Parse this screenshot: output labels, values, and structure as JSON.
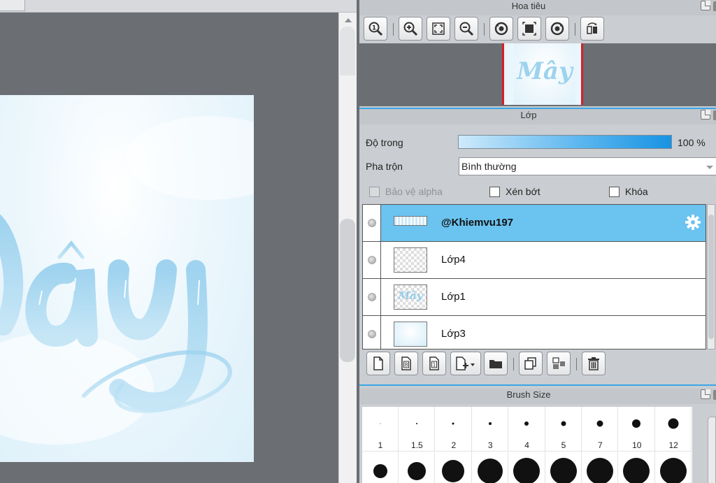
{
  "navigator": {
    "title": "Hoa tiêu",
    "preview_text": "Mây",
    "tools": [
      "zoom-actual-icon",
      "zoom-in-icon",
      "fit-window-icon",
      "zoom-out-icon",
      "rotate-left-icon",
      "fit-canvas-icon",
      "rotate-right-icon",
      "flip-horizontal-icon"
    ]
  },
  "canvas": {
    "art_text": "Mây"
  },
  "layers": {
    "title": "Lớp",
    "opacity_label": "Độ trong",
    "opacity_value": "100 %",
    "opacity_fraction": 1.0,
    "blend_label": "Pha trộn",
    "blend_value": "Bình thường",
    "protect_alpha_label": "Bảo vệ alpha",
    "clipping_label": "Xén bớt",
    "lock_label": "Khóa",
    "items": [
      {
        "name": "@Khiemvu197",
        "active": true,
        "thumb": "banner"
      },
      {
        "name": "Lớp4",
        "active": false,
        "thumb": "transparent"
      },
      {
        "name": "Lớp1",
        "active": false,
        "thumb": "text",
        "thumb_text": "Mây"
      },
      {
        "name": "Lớp3",
        "active": false,
        "thumb": "sky"
      }
    ],
    "tools": [
      "new-layer-icon",
      "new-8bit-layer-icon",
      "new-1bit-layer-icon",
      "add-layer-dropdown-icon",
      "new-folder-icon",
      "duplicate-layer-icon",
      "merge-down-icon",
      "delete-layer-icon"
    ],
    "colors": {
      "active_row": "#6bc3ef",
      "accent": "#3aa6e6"
    }
  },
  "brush_size": {
    "title": "Brush Size",
    "sizes": [
      {
        "label": "1",
        "dot": 1
      },
      {
        "label": "1.5",
        "dot": 2
      },
      {
        "label": "2",
        "dot": 3
      },
      {
        "label": "3",
        "dot": 4
      },
      {
        "label": "4",
        "dot": 6
      },
      {
        "label": "5",
        "dot": 7
      },
      {
        "label": "7",
        "dot": 9
      },
      {
        "label": "10",
        "dot": 12
      },
      {
        "label": "12",
        "dot": 15
      }
    ],
    "second_row_dots": [
      20,
      26,
      32,
      36,
      38,
      38,
      38,
      38,
      38
    ]
  }
}
